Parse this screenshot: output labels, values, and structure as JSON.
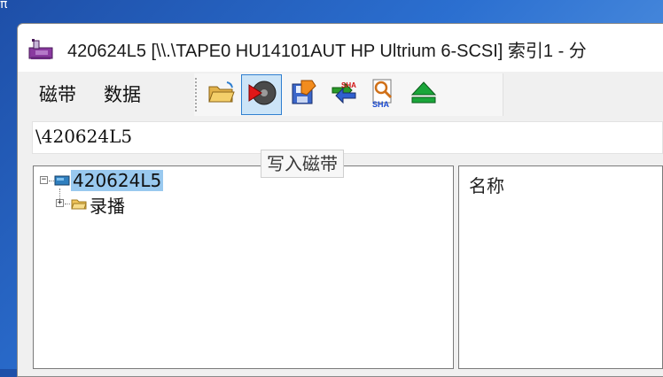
{
  "desktop": {
    "corner_text": "π"
  },
  "window": {
    "title": "420624L5 [\\\\.\\TAPE0 HU14101AUT HP Ultrium 6-SCSI] 索引1 - 分"
  },
  "menu": {
    "items": [
      "磁带",
      "数据"
    ]
  },
  "toolbar": {
    "buttons": [
      {
        "name": "open-folder",
        "icon": "open-folder-icon",
        "active": false
      },
      {
        "name": "write-tape",
        "icon": "write-tape-icon",
        "active": true
      },
      {
        "name": "save-index",
        "icon": "save-index-icon",
        "active": false
      },
      {
        "name": "sha-compare",
        "icon": "sha-compare-icon",
        "active": false
      },
      {
        "name": "sha-search",
        "icon": "sha-search-icon",
        "active": false
      },
      {
        "name": "eject",
        "icon": "eject-icon",
        "active": false
      }
    ],
    "tooltip": "写入磁带"
  },
  "path": {
    "value": "\\420624L5"
  },
  "tree": {
    "root": {
      "label": "420624L5",
      "expanded": true,
      "selected": true
    },
    "children": [
      {
        "label": "录播",
        "expanded": false
      }
    ]
  },
  "list": {
    "columns": [
      "名称"
    ]
  },
  "colors": {
    "selection": "#99c9ef",
    "active_button_bg": "#cce4f7",
    "active_button_border": "#2f7fd0",
    "desktop": "#2b6fd0"
  }
}
